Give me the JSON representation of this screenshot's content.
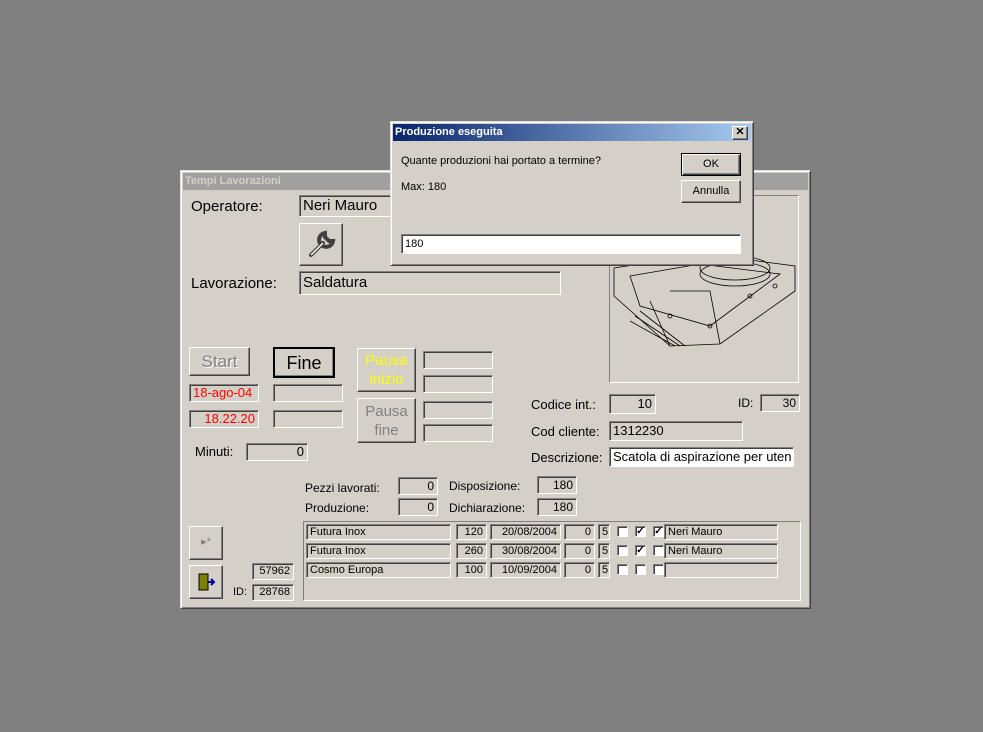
{
  "main_window": {
    "title": "Tempi Lavorazioni",
    "operator_label": "Operatore:",
    "operator_value": "Neri Mauro",
    "work_label": "Lavorazione:",
    "work_value": "Saldatura",
    "start_label": "Start",
    "end_label": "Fine",
    "pause_start_label": "Pausa inizio",
    "pause_end_label": "Pausa fine",
    "date_value": "18-ago-04",
    "time_value": "18.22.20",
    "minutes_label": "Minuti:",
    "minutes_value": "0",
    "code_label": "Codice  int.:",
    "code_value": "10",
    "id_label": "ID:",
    "id_value": "30",
    "client_label": "Cod cliente:",
    "client_value": "1312230",
    "description_label": "Descrizione:",
    "description_value": "Scatola di aspirazione per uten",
    "pieces_label": "Pezzi lavorati:",
    "pieces_value": "0",
    "production_label": "Produzione:",
    "production_value": "0",
    "disposition_label": "Disposizione:",
    "disposition_value": "180",
    "declaration_label": "Dichiarazione:",
    "declaration_value": "180",
    "record_value": "57962",
    "bottom_id_label": "ID:",
    "bottom_id_value": "28768",
    "new_record_icon": "new-record-icon",
    "exit_icon": "exit-door-icon",
    "tool_icon": "wrench-icon",
    "date_color": "#ff0000",
    "pause_start_color": "#ffff00"
  },
  "orders": [
    {
      "client": "Futura Inox",
      "qty": "120",
      "date": "20/08/2004",
      "a": "0",
      "b": "5",
      "c1": false,
      "c2": true,
      "c3": true,
      "operator": "Neri Mauro"
    },
    {
      "client": "Futura Inox",
      "qty": "260",
      "date": "30/08/2004",
      "a": "0",
      "b": "5",
      "c1": false,
      "c2": true,
      "c3": false,
      "operator": "Neri Mauro"
    },
    {
      "client": "Cosmo Europa",
      "qty": "100",
      "date": "10/09/2004",
      "a": "0",
      "b": "5",
      "c1": false,
      "c2": false,
      "c3": false,
      "operator": ""
    }
  ],
  "dialog": {
    "title": "Produzione eseguita",
    "question": "Quante produzioni hai portato a termine?",
    "max_label": "Max:  180",
    "ok_label": "OK",
    "cancel_label": "Annulla",
    "input_value": "180",
    "close_icon": "close-icon"
  }
}
